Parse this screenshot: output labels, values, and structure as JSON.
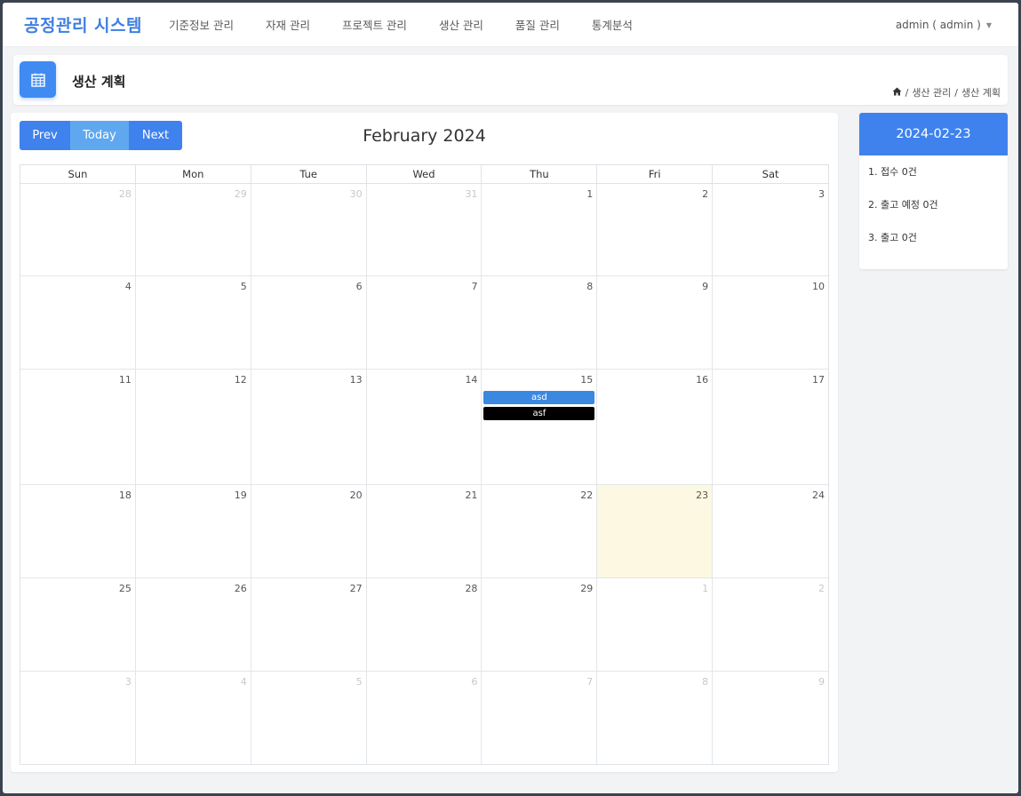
{
  "nav": {
    "brand": "공정관리 시스템",
    "menu": [
      "기준정보 관리",
      "자재 관리",
      "프로젝트 관리",
      "생산 관리",
      "품질 관리",
      "통계분석"
    ],
    "user": "admin ( admin )"
  },
  "page": {
    "title": "생산 계획",
    "breadcrumb": [
      "생산 관리",
      "생산 계획"
    ]
  },
  "calendar": {
    "buttons": {
      "prev": "Prev",
      "today": "Today",
      "next": "Next"
    },
    "title": "February 2024",
    "weekdays": [
      "Sun",
      "Mon",
      "Tue",
      "Wed",
      "Thu",
      "Fri",
      "Sat"
    ],
    "weeks": [
      [
        {
          "n": "28",
          "o": true
        },
        {
          "n": "29",
          "o": true
        },
        {
          "n": "30",
          "o": true
        },
        {
          "n": "31",
          "o": true
        },
        {
          "n": "1"
        },
        {
          "n": "2"
        },
        {
          "n": "3"
        }
      ],
      [
        {
          "n": "4"
        },
        {
          "n": "5"
        },
        {
          "n": "6"
        },
        {
          "n": "7"
        },
        {
          "n": "8"
        },
        {
          "n": "9"
        },
        {
          "n": "10"
        }
      ],
      [
        {
          "n": "11"
        },
        {
          "n": "12"
        },
        {
          "n": "13"
        },
        {
          "n": "14"
        },
        {
          "n": "15",
          "events": [
            {
              "title": "asd",
              "color": "#3b88e0"
            },
            {
              "title": "asf",
              "color": "#000000"
            }
          ]
        },
        {
          "n": "16"
        },
        {
          "n": "17"
        }
      ],
      [
        {
          "n": "18"
        },
        {
          "n": "19"
        },
        {
          "n": "20"
        },
        {
          "n": "21"
        },
        {
          "n": "22"
        },
        {
          "n": "23",
          "today": true
        },
        {
          "n": "24"
        }
      ],
      [
        {
          "n": "25"
        },
        {
          "n": "26"
        },
        {
          "n": "27"
        },
        {
          "n": "28"
        },
        {
          "n": "29"
        },
        {
          "n": "1",
          "o": true
        },
        {
          "n": "2",
          "o": true
        }
      ],
      [
        {
          "n": "3",
          "o": true
        },
        {
          "n": "4",
          "o": true
        },
        {
          "n": "5",
          "o": true
        },
        {
          "n": "6",
          "o": true
        },
        {
          "n": "7",
          "o": true
        },
        {
          "n": "8",
          "o": true
        },
        {
          "n": "9",
          "o": true
        }
      ]
    ]
  },
  "side": {
    "date": "2024-02-23",
    "items": [
      "1. 접수 0건",
      "2. 출고 예정 0건",
      "3. 출고 0건"
    ]
  },
  "colors": {
    "brand": "#3f7fe0",
    "primary": "#3f82ee",
    "today_bg": "#fdf8e1"
  },
  "icons": {
    "page_icon": "calendar-icon",
    "home": "home-icon",
    "user_caret": "caret-down-icon"
  }
}
